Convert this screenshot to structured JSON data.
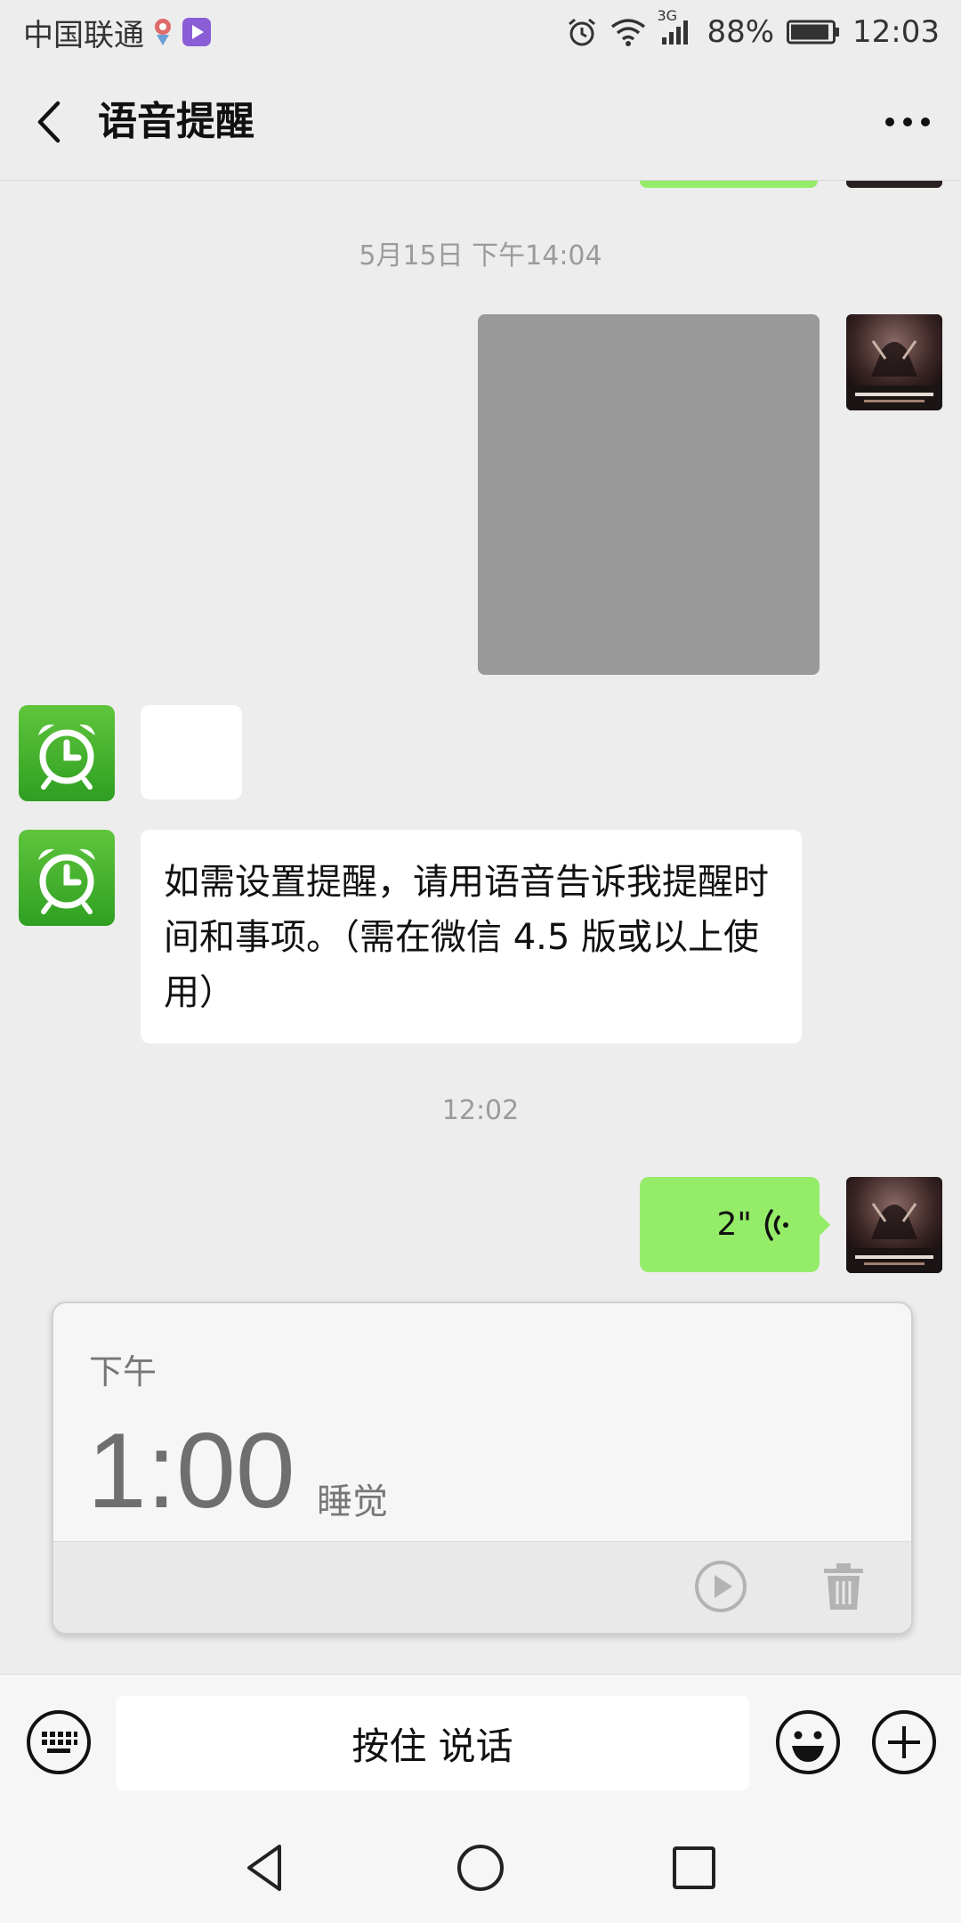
{
  "status_bar": {
    "carrier": "中国联通",
    "network": "3G",
    "battery": "88%",
    "time": "12:03"
  },
  "header": {
    "title": "语音提醒"
  },
  "chat": {
    "timestamp_1": "5月15日 下午14:04",
    "bot_message": "如需设置提醒，请用语音告诉我提醒时间和事项。（需在微信 4.5 版或以上使用）",
    "timestamp_2": "12:02",
    "voice_duration": "2\""
  },
  "reminder": {
    "period": "下午",
    "time": "1:00",
    "task": "睡觉"
  },
  "input_bar": {
    "hold_to_talk": "按住 说话"
  },
  "colors": {
    "background": "#ededed",
    "voice_bubble": "#95ec69",
    "bot_avatar": "#3aaa2a"
  }
}
